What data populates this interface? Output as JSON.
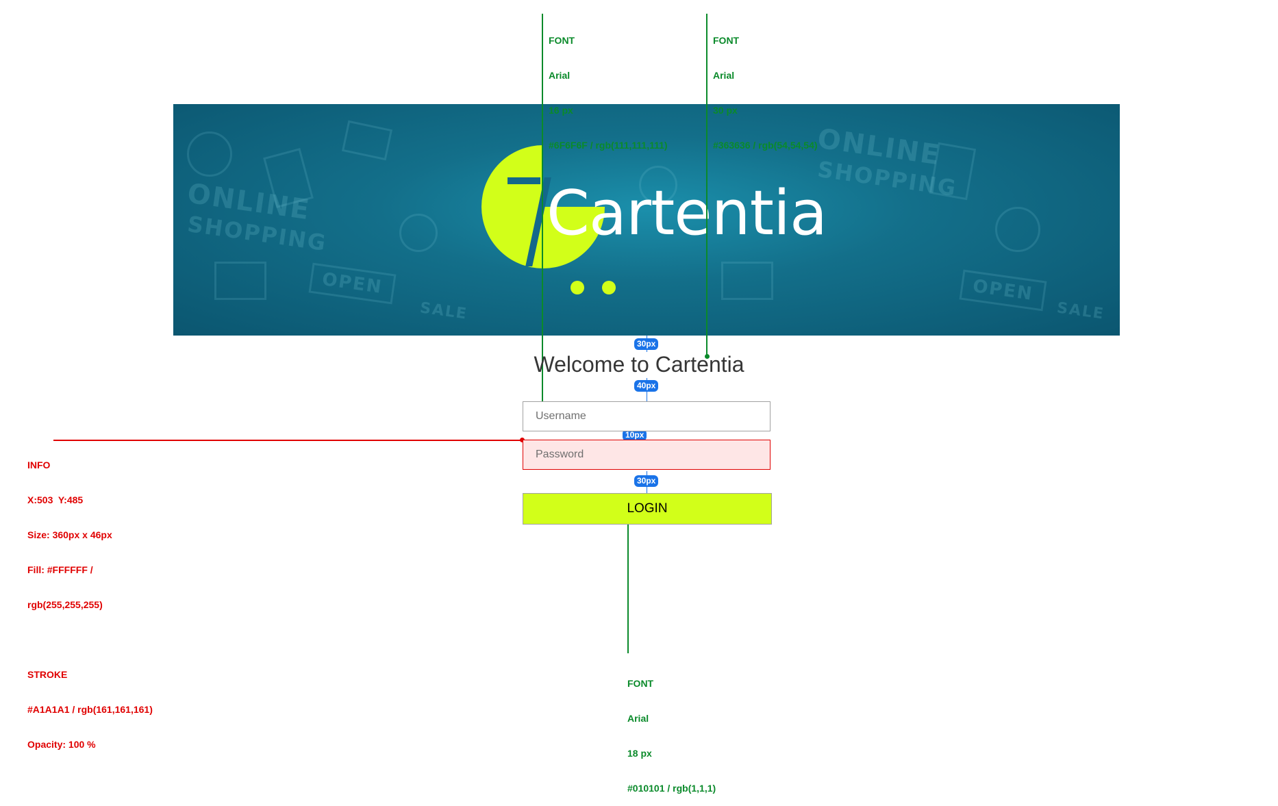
{
  "colors": {
    "accent": "#d2ff19",
    "banner": "#136f8a",
    "annotation_green": "#0a8a2a",
    "annotation_red": "#e00000",
    "measure_blue": "#1a73e8"
  },
  "banner": {
    "logo_text": "Cartentia",
    "doodle_words": [
      "ONLINE",
      "SHOPPING",
      "OPEN",
      "SALE"
    ]
  },
  "welcome": {
    "title": "Welcome to Cartentia"
  },
  "form": {
    "username_placeholder": "Username",
    "password_placeholder": "Password",
    "login_label": "LOGIN"
  },
  "annotations": {
    "font_username": [
      "FONT",
      "Arial",
      "16 px",
      "#6F6F6F / rgb(111,111,111)"
    ],
    "font_title": [
      "FONT",
      "Arial",
      "30 px",
      "#363636 / rgb(54,54,54)"
    ],
    "font_login": [
      "FONT",
      "Arial",
      "18 px",
      "#010101 / rgb(1,1,1)"
    ],
    "info": [
      "INFO",
      "X:503  Y:485",
      "Size: 360px x 46px",
      "Fill: #FFFFFF /",
      "rgb(255,255,255)",
      "",
      "STROKE",
      "#A1A1A1 / rgb(161,161,161)",
      "Opacity: 100 %"
    ],
    "gaps": [
      "30px",
      "40px",
      "10px",
      "30px"
    ]
  }
}
